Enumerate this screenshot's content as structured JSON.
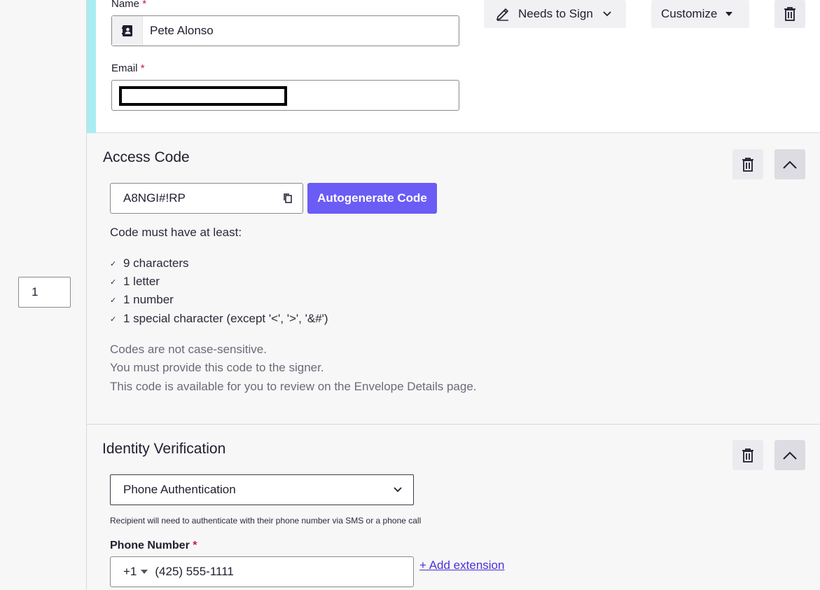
{
  "recipient": {
    "order": "1",
    "name_label": "Name",
    "name_value": "Pete Alonso",
    "email_label": "Email",
    "required_mark": "*",
    "action_label": "Needs to Sign",
    "customize_label": "Customize"
  },
  "access_code": {
    "title": "Access Code",
    "code_value": "A8NGI#!RP",
    "autogenerate_label": "Autogenerate Code",
    "rules_intro": "Code must have at least:",
    "rules": [
      "9 characters",
      "1 letter",
      "1 number",
      "1 special character (except '<', '>', '&#')"
    ],
    "notes": [
      "Codes are not case-sensitive.",
      "You must provide this code to the signer.",
      "This code is available for you to review on the Envelope Details page."
    ]
  },
  "identity": {
    "title": "Identity Verification",
    "method_selected": "Phone Authentication",
    "method_help": "Recipient will need to authenticate with their phone number via SMS or a phone call",
    "phone_label": "Phone Number",
    "country_code": "+1",
    "phone_value": "(425) 555-1111",
    "add_extension_label": "+ Add extension"
  },
  "colors": {
    "accent": "#a9ecf2",
    "primary_button": "#6b5cf6",
    "required": "#c21a4a",
    "link": "#4b2fd8"
  }
}
